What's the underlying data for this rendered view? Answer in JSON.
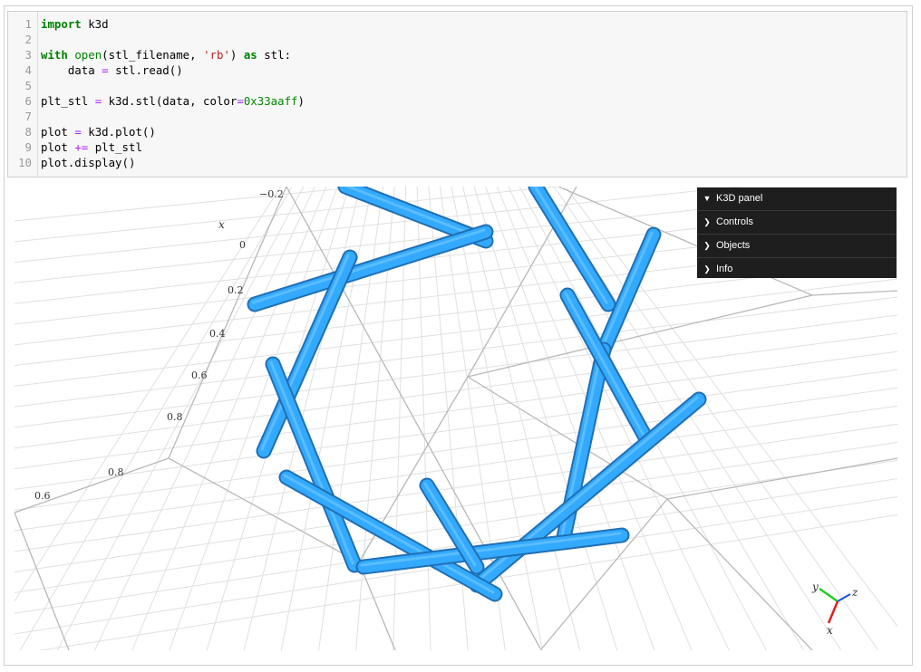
{
  "code": {
    "lines": [
      {
        "n": "1",
        "tokens": [
          {
            "t": "import",
            "c": "kw"
          },
          {
            "t": " k3d",
            "c": ""
          }
        ]
      },
      {
        "n": "2",
        "tokens": []
      },
      {
        "n": "3",
        "tokens": [
          {
            "t": "with",
            "c": "kw"
          },
          {
            "t": " ",
            "c": ""
          },
          {
            "t": "open",
            "c": "bi"
          },
          {
            "t": "(stl_filename, ",
            "c": ""
          },
          {
            "t": "'rb'",
            "c": "str"
          },
          {
            "t": ") ",
            "c": ""
          },
          {
            "t": "as",
            "c": "kw"
          },
          {
            "t": " stl:",
            "c": ""
          }
        ]
      },
      {
        "n": "4",
        "tokens": [
          {
            "t": "    data ",
            "c": ""
          },
          {
            "t": "=",
            "c": "op"
          },
          {
            "t": " stl.read()",
            "c": ""
          }
        ]
      },
      {
        "n": "5",
        "tokens": []
      },
      {
        "n": "6",
        "tokens": [
          {
            "t": "plt_stl ",
            "c": ""
          },
          {
            "t": "=",
            "c": "op"
          },
          {
            "t": " k3d.stl(data, color",
            "c": ""
          },
          {
            "t": "=",
            "c": "op"
          },
          {
            "t": "0x33aaff",
            "c": "num"
          },
          {
            "t": ")",
            "c": ""
          }
        ]
      },
      {
        "n": "7",
        "tokens": []
      },
      {
        "n": "8",
        "tokens": [
          {
            "t": "plot ",
            "c": ""
          },
          {
            "t": "=",
            "c": "op"
          },
          {
            "t": " k3d.plot()",
            "c": ""
          }
        ]
      },
      {
        "n": "9",
        "tokens": [
          {
            "t": "plot ",
            "c": ""
          },
          {
            "t": "+=",
            "c": "op"
          },
          {
            "t": " plt_stl",
            "c": ""
          }
        ]
      },
      {
        "n": "10",
        "tokens": [
          {
            "t": "plot.display()",
            "c": ""
          }
        ]
      }
    ]
  },
  "panel": {
    "title": "K3D panel",
    "items": [
      "Controls",
      "Objects",
      "Info"
    ]
  },
  "axes": {
    "x_label": "x",
    "ticks": [
      "−0.2",
      "0",
      "0.2",
      "0.4",
      "0.6",
      "0.8",
      "0.8",
      "0.6"
    ],
    "gizmo": {
      "y": "y",
      "z": "z",
      "x": "x"
    }
  },
  "colors": {
    "mesh": "#33aaff",
    "mesh_dark": "#1f6fb4",
    "mesh_light": "#6cc6ff",
    "grid": "#e0e0e0",
    "grid_major": "#b8b8b8"
  }
}
